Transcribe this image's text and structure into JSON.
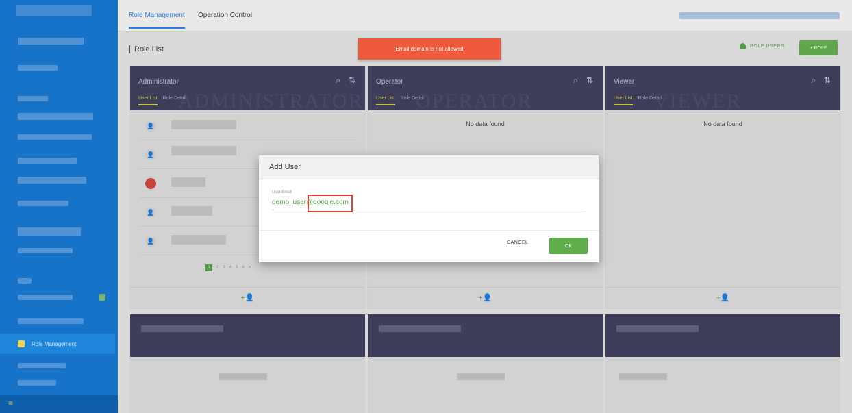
{
  "nav": {
    "active_item": "Role Management"
  },
  "tabs": [
    {
      "label": "Role Management",
      "active": true
    },
    {
      "label": "Operation Control",
      "active": false
    }
  ],
  "page": {
    "title": "Role List",
    "role_users_label": "ROLE USERS",
    "add_role_label": "+ ROLE"
  },
  "toast": {
    "message": "Email domain is not allowed",
    "color": "#ee5a3b"
  },
  "roles": [
    {
      "name": "Administrator",
      "tab_user_list": "User List",
      "tab_role_detail": "Role Detail",
      "watermark": "ADMINISTRATOR",
      "pager": [
        "1",
        "2",
        "3",
        "4",
        "5",
        "6",
        ">"
      ]
    },
    {
      "name": "Operator",
      "tab_user_list": "User List",
      "tab_role_detail": "Role Detail",
      "watermark": "OPERATOR",
      "empty_text": "No data found"
    },
    {
      "name": "Viewer",
      "tab_user_list": "User List",
      "tab_role_detail": "Role Detail",
      "watermark": "VIEWER",
      "empty_text": "No data found"
    }
  ],
  "modal": {
    "title": "Add User",
    "field_label": "User Email",
    "field_value": "demo_user@google.com",
    "cancel_label": "CANCEL",
    "ok_label": "OK"
  },
  "colors": {
    "sidebar": "#1673c8",
    "card_header": "#3f3e5a",
    "accent_green": "#5fae4b",
    "highlight_red": "#e0413a"
  }
}
